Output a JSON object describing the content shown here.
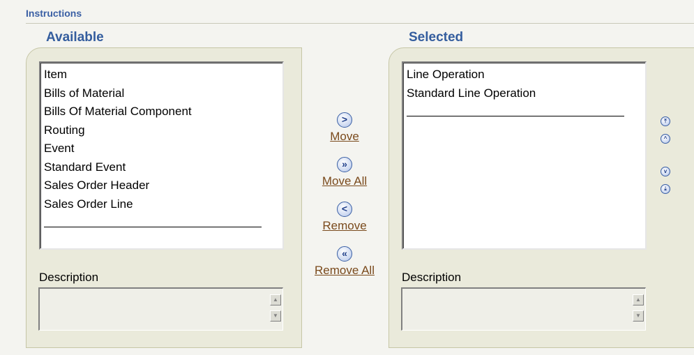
{
  "instructions": "Instructions",
  "available": {
    "heading": "Available",
    "items": [
      "Item",
      "Bills of Material",
      "Bills Of Material Component",
      "Routing",
      "Event",
      "Standard Event",
      "Sales Order Header",
      "Sales Order Line"
    ],
    "description_label": "Description"
  },
  "selected": {
    "heading": "Selected",
    "items": [
      "Line Operation",
      "Standard Line Operation"
    ],
    "description_label": "Description"
  },
  "shuttle": {
    "move": "Move",
    "move_all": "Move All",
    "remove": "Remove",
    "remove_all": "Remove All"
  },
  "icons": {
    "move": "chevron-right-icon",
    "move_all": "double-chevron-right-icon",
    "remove": "chevron-left-icon",
    "remove_all": "double-chevron-left-icon",
    "move_top": "move-to-top-icon",
    "move_up": "move-up-icon",
    "move_down": "move-down-icon",
    "move_bottom": "move-to-bottom-icon"
  },
  "colors": {
    "heading": "#345d9e",
    "link": "#7a4a1c",
    "panel": "#eaeadb"
  }
}
